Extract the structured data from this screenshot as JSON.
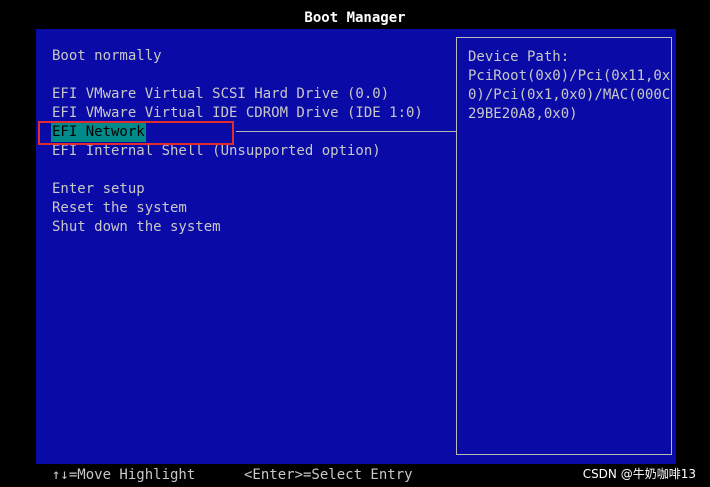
{
  "title": "Boot Manager",
  "menu": {
    "items": [
      {
        "label": "Boot normally",
        "selected": false
      },
      {
        "label": "EFI VMware Virtual SCSI Hard Drive (0.0)",
        "selected": false
      },
      {
        "label": "EFI VMware Virtual IDE CDROM Drive (IDE 1:0)",
        "selected": false
      },
      {
        "label": "EFI Network",
        "selected": true
      },
      {
        "label": "EFI Internal Shell (Unsupported option)",
        "selected": false
      },
      {
        "label": "Enter setup",
        "selected": false
      },
      {
        "label": "Reset the system",
        "selected": false
      },
      {
        "label": "Shut down the system",
        "selected": false
      }
    ]
  },
  "info_panel": {
    "line1": "Device Path:",
    "line2": "PciRoot(0x0)/Pci(0x11,0x",
    "line3": "0)/Pci(0x1,0x0)/MAC(000C",
    "line4": "29BE20A8,0x0)"
  },
  "footer": {
    "move_hint": "↑↓=Move Highlight",
    "select_hint": "<Enter>=Select Entry"
  },
  "watermark": "CSDN @牛奶咖啡13",
  "colors": {
    "screen_background": "#0a0aa6",
    "selected_background": "#008a8a",
    "annotation_box": "#e02d2d"
  }
}
